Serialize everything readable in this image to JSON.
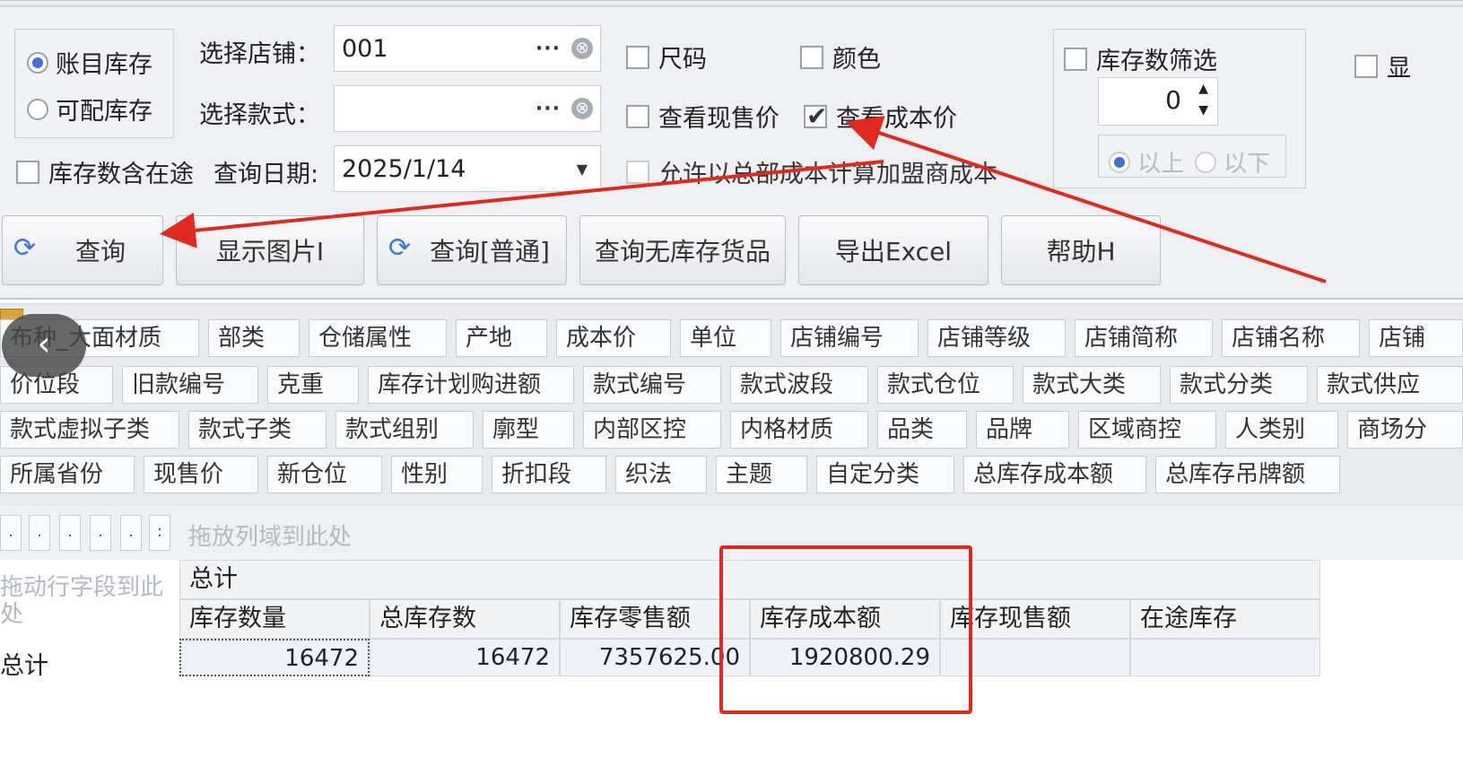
{
  "filters": {
    "stock_type_options": [
      {
        "label": "账目库存",
        "selected": true
      },
      {
        "label": "可配库存",
        "selected": false
      }
    ],
    "store_label": "选择店铺：",
    "store_value": "001",
    "style_label": "选择款式：",
    "style_value": "",
    "ellipsis": "···",
    "clear_icon": "⊗",
    "include_transit_label": "库存数含在途",
    "date_label": "查询日期:",
    "date_value": "2025/1/14",
    "size_label": "尺码",
    "color_label": "颜色",
    "view_current_price_label": "查看现售价",
    "view_cost_price_label": "查看成本价",
    "view_cost_price_checked": true,
    "allow_hq_cost_label": "允许以总部成本计算加盟商成本",
    "stock_filter_label": "库存数筛选",
    "stock_filter_value": "0",
    "above_label": "以上",
    "below_label": "以下",
    "cut_label": "显"
  },
  "toolbar": {
    "query": "查询",
    "show_image": "显示图片I",
    "query_normal": "查询[普通]",
    "query_no_stock": "查询无库存货品",
    "export_excel": "导出Excel",
    "help": "帮助H"
  },
  "back_button": "‹",
  "field_chips": {
    "row1": [
      "布种_大面材质",
      "部类",
      "仓储属性",
      "产地",
      "成本价",
      "单位",
      "店铺编号",
      "店铺等级",
      "店铺简称",
      "店铺名称",
      "店铺"
    ],
    "row2": [
      "价位段",
      "旧款编号",
      "克重",
      "库存计划购进额",
      "款式编号",
      "款式波段",
      "款式仓位",
      "款式大类",
      "款式分类",
      "款式供应"
    ],
    "row3": [
      "款式虚拟子类",
      "款式子类",
      "款式组别",
      "廓型",
      "内部区控",
      "内格材质",
      "品类",
      "品牌",
      "区域商控",
      "人类别",
      "商场分"
    ],
    "row4": [
      "所属省份",
      "现售价",
      "新仓位",
      "性别",
      "折扣段",
      "织法",
      "主题",
      "自定分类",
      "总库存成本额",
      "总库存吊牌额"
    ]
  },
  "drop_row": {
    "small_boxes": [
      ".",
      ".",
      ".",
      ".",
      ".",
      ":"
    ],
    "hint": "拖放列域到此处"
  },
  "pivot": {
    "row_drop_hint": "拖动行字段到此处",
    "group_header": "总计",
    "columns": [
      "库存数量",
      "总库存数",
      "库存零售额",
      "库存成本额",
      "库存现售额",
      "在途库存"
    ],
    "row_label": "总计",
    "values": [
      "16472",
      "16472",
      "7357625.00",
      "1920800.29",
      "",
      ""
    ]
  },
  "colors": {
    "annotation_red": "#e12a1f",
    "radio_blue": "#3e6fd6",
    "refresh_icon_blue": "#3b78d8"
  },
  "icons": {
    "refresh": "⟳"
  }
}
